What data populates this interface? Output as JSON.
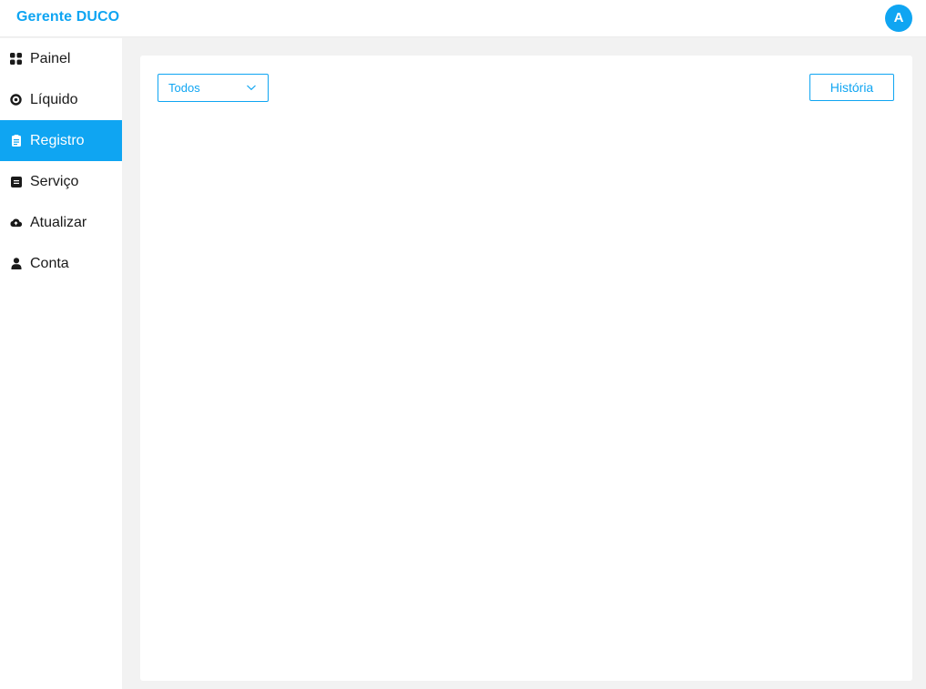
{
  "app": {
    "title": "Gerente DUCO",
    "avatar_initial": "A"
  },
  "sidebar": {
    "items": [
      {
        "label": "Painel",
        "icon": "grid-icon",
        "active": false
      },
      {
        "label": "Líquido",
        "icon": "target-icon",
        "active": false
      },
      {
        "label": "Registro",
        "icon": "clipboard-icon",
        "active": true
      },
      {
        "label": "Serviço",
        "icon": "card-icon",
        "active": false
      },
      {
        "label": "Atualizar",
        "icon": "cloud-upload-icon",
        "active": false
      },
      {
        "label": "Conta",
        "icon": "user-icon",
        "active": false
      }
    ]
  },
  "main": {
    "filter": {
      "selected": "Todos"
    },
    "history_button": "História"
  },
  "colors": {
    "accent": "#0fa5f2",
    "background": "#f2f2f2",
    "surface": "#ffffff"
  }
}
